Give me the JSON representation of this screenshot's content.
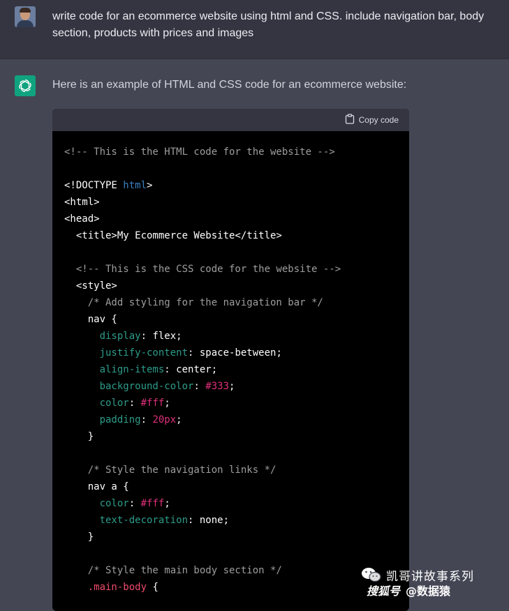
{
  "user_message": {
    "text": "write code for an ecommerce website using html and CSS. include navigation bar, body section, products with prices and images"
  },
  "assistant": {
    "intro": "Here is an example of HTML and CSS code for an ecommerce website:",
    "copy_label": "Copy code",
    "code_lines": [
      [
        {
          "t": "<!-- This is the HTML code for the website -->",
          "c": "com"
        }
      ],
      [],
      [
        {
          "t": "<!DOCTYPE ",
          "c": "tag"
        },
        {
          "t": "html",
          "c": "attr"
        },
        {
          "t": ">",
          "c": "tag"
        }
      ],
      [
        {
          "t": "<html>",
          "c": "tag"
        }
      ],
      [
        {
          "t": "<head>",
          "c": "tag"
        }
      ],
      [
        {
          "t": "  <title>My Ecommerce Website</title>",
          "c": "tag"
        }
      ],
      [],
      [
        {
          "t": "  <!-- This is the CSS code for the website -->",
          "c": "com"
        }
      ],
      [
        {
          "t": "  <style>",
          "c": "tag"
        }
      ],
      [
        {
          "t": "    /* Add styling for the navigation bar */",
          "c": "com"
        }
      ],
      [
        {
          "t": "    nav {",
          "c": "sel"
        }
      ],
      [
        {
          "t": "      ",
          "c": "val"
        },
        {
          "t": "display",
          "c": "prop"
        },
        {
          "t": ": flex;",
          "c": "val"
        }
      ],
      [
        {
          "t": "      ",
          "c": "val"
        },
        {
          "t": "justify-content",
          "c": "prop"
        },
        {
          "t": ": space-between;",
          "c": "val"
        }
      ],
      [
        {
          "t": "      ",
          "c": "val"
        },
        {
          "t": "align-items",
          "c": "prop"
        },
        {
          "t": ": center;",
          "c": "val"
        }
      ],
      [
        {
          "t": "      ",
          "c": "val"
        },
        {
          "t": "background-color",
          "c": "prop"
        },
        {
          "t": ": ",
          "c": "val"
        },
        {
          "t": "#333",
          "c": "col"
        },
        {
          "t": ";",
          "c": "val"
        }
      ],
      [
        {
          "t": "      ",
          "c": "val"
        },
        {
          "t": "color",
          "c": "prop"
        },
        {
          "t": ": ",
          "c": "val"
        },
        {
          "t": "#fff",
          "c": "col"
        },
        {
          "t": ";",
          "c": "val"
        }
      ],
      [
        {
          "t": "      ",
          "c": "val"
        },
        {
          "t": "padding",
          "c": "prop"
        },
        {
          "t": ": ",
          "c": "val"
        },
        {
          "t": "20px",
          "c": "col"
        },
        {
          "t": ";",
          "c": "val"
        }
      ],
      [
        {
          "t": "    }",
          "c": "sel"
        }
      ],
      [],
      [
        {
          "t": "    /* Style the navigation links */",
          "c": "com"
        }
      ],
      [
        {
          "t": "    nav a {",
          "c": "sel"
        }
      ],
      [
        {
          "t": "      ",
          "c": "val"
        },
        {
          "t": "color",
          "c": "prop"
        },
        {
          "t": ": ",
          "c": "val"
        },
        {
          "t": "#fff",
          "c": "col"
        },
        {
          "t": ";",
          "c": "val"
        }
      ],
      [
        {
          "t": "      ",
          "c": "val"
        },
        {
          "t": "text-decoration",
          "c": "prop"
        },
        {
          "t": ": none;",
          "c": "val"
        }
      ],
      [
        {
          "t": "    }",
          "c": "sel"
        }
      ],
      [],
      [
        {
          "t": "    /* Style the main body section */",
          "c": "com"
        }
      ],
      [
        {
          "t": "    ",
          "c": "val"
        },
        {
          "t": ".main-body",
          "c": "cls"
        },
        {
          "t": " {",
          "c": "sel"
        }
      ]
    ]
  },
  "watermark": {
    "line1": "凯哥讲故事系列",
    "line2": "@数据猿",
    "logo_text": "搜狐号"
  },
  "colors": {
    "page_bg": "#444654",
    "user_bg": "#343541",
    "code_bg": "#000000",
    "openai_green": "#10a37f"
  }
}
